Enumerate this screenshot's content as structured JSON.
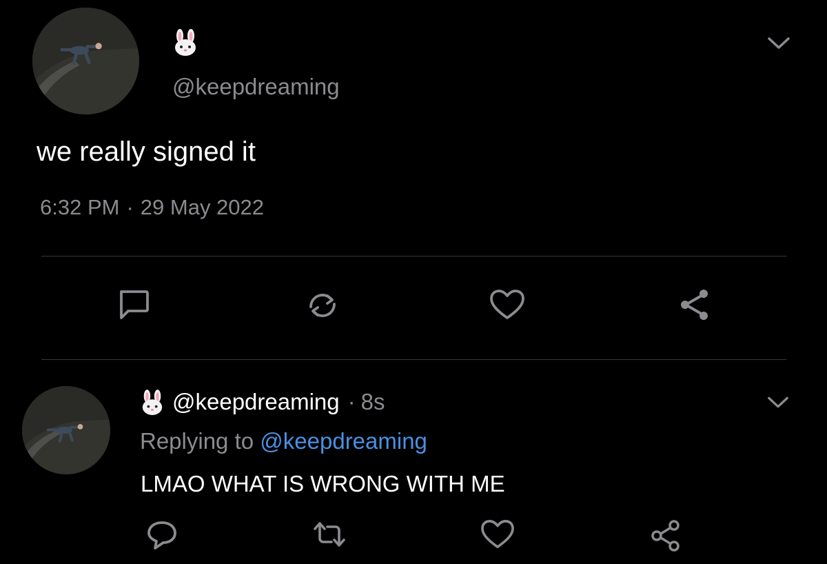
{
  "colors": {
    "background": "#000000",
    "primary_text": "#ffffff",
    "secondary_text": "#8b8b90",
    "mention": "#4a90e2",
    "icon": "#8b8b90",
    "divider": "#3a3a3c"
  },
  "main_tweet": {
    "display_name_icon": "rabbit-face-emoji",
    "handle": "@keepdreaming",
    "text": "we really signed it",
    "time": "6:32 PM",
    "separator": "·",
    "date": "29 May 2022",
    "actions": [
      "reply-icon",
      "retweet-icon",
      "like-icon",
      "share-icon"
    ],
    "menu_icon": "chevron-down-icon"
  },
  "reply_tweet": {
    "display_name_icon": "rabbit-face-emoji",
    "handle": "@keepdreaming",
    "separator": "·",
    "time_ago": "8s",
    "replying_prefix": "Replying to",
    "replying_to": "@keepdreaming",
    "text": "LMAO WHAT IS WRONG WITH ME",
    "actions": [
      "reply-icon",
      "retweet-icon",
      "like-icon",
      "share-icon"
    ],
    "menu_icon": "chevron-down-icon"
  }
}
